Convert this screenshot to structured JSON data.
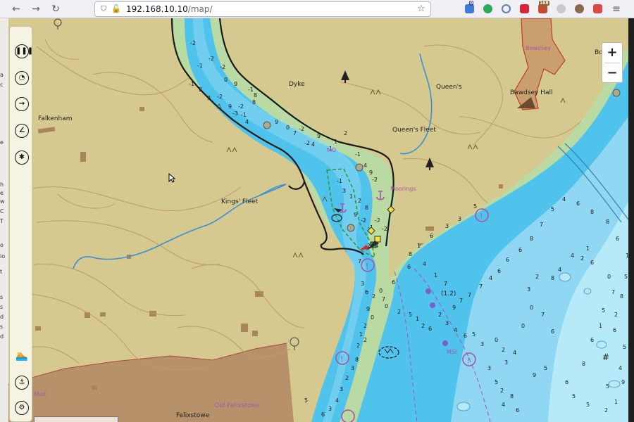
{
  "browser": {
    "address": "192.168.10.10/map/",
    "address_host": "192.168.10.10",
    "address_path": "/map/",
    "extension_badges": {
      "ext1": "0",
      "ext6": "168"
    }
  },
  "map": {
    "places": [
      {
        "id": "falkenham",
        "text": "Falkenham"
      },
      {
        "id": "kings-fleet",
        "text": "Kings' Fleet"
      },
      {
        "id": "dyke",
        "text": "Dyke"
      },
      {
        "id": "queens",
        "text": "Queen's"
      },
      {
        "id": "queens-fleet",
        "text": "Queen's Fleet"
      },
      {
        "id": "bawdsey-hall",
        "text": "Bawdsey Hall"
      },
      {
        "id": "bawdsey",
        "text": "Bawdsey"
      },
      {
        "id": "boathouse",
        "text": "Boathse"
      },
      {
        "id": "moorings",
        "text": "Moorings"
      },
      {
        "id": "felixstowe",
        "text": "Felixstowe"
      },
      {
        "id": "old-felixstowe",
        "text": "Old Felixstowe"
      },
      {
        "id": "mud-label",
        "text": "Mud"
      },
      {
        "id": "mo-label",
        "text": "MO"
      },
      {
        "id": "msi-label",
        "text": "MSt"
      },
      {
        "id": "height-label",
        "text": "(1.2)"
      }
    ],
    "colors": {
      "land": "#d5c98f",
      "urban": "#b7916a",
      "intertidal": "#b9dba3",
      "shallow": "#4fc3ec",
      "mid": "#8fd7f2",
      "deep": "#b6eaf8",
      "contour": "#c09a62",
      "coast": "#1a1a1a"
    },
    "soundings": [
      "-2",
      "-1",
      "-2",
      "-2",
      "-1",
      "2",
      "3",
      "-2",
      "0",
      "9",
      "-1",
      "8",
      "9",
      "-3",
      "-2",
      "-1",
      "4",
      "8",
      "9",
      "0",
      "7",
      "-2",
      "-2",
      "4",
      "9",
      "-1",
      "1",
      "2",
      "-1",
      "4",
      "9",
      "-2",
      "-1",
      "3",
      "1",
      "2",
      "8",
      "9",
      "-2",
      "-1",
      "-2",
      "-2",
      "-2",
      "4",
      "7",
      "3",
      "6",
      "2",
      "0",
      "7",
      "0",
      "9",
      "0",
      "2",
      "1",
      "2",
      "2",
      "8",
      "3",
      "2",
      "3",
      "4",
      "3",
      "6",
      "5",
      "6",
      "6",
      "2",
      "5",
      "1",
      "2",
      "6",
      "2",
      "3",
      "4",
      "6",
      "5",
      "3",
      "0",
      "2",
      "3",
      "3",
      "4",
      "5",
      "2",
      "8",
      "4",
      "6",
      "9",
      "5",
      "6",
      "7",
      "0",
      "0",
      "3",
      "2",
      "8",
      "4",
      "4",
      "2",
      "1",
      "6",
      "0",
      "7",
      "5",
      "1",
      "6",
      "8",
      "6",
      "5",
      "5",
      "2",
      "1",
      "9",
      "5",
      "4",
      "5",
      "6",
      "2",
      "8",
      "5",
      "1",
      "6",
      "8",
      "8",
      "6",
      "4",
      "5",
      "7",
      "8",
      "6",
      "6",
      "6",
      "4",
      "7",
      "7",
      "7",
      "9",
      "7",
      "1",
      "4",
      "8",
      "1",
      "6",
      "3",
      "3",
      "5"
    ]
  },
  "tools": {
    "panel_buttons": [
      {
        "id": "layers",
        "icon": "layers-icon",
        "glyph": "❚❚❚"
      },
      {
        "id": "timer",
        "icon": "timer-icon",
        "glyph": "◔"
      },
      {
        "id": "route",
        "icon": "route-icon",
        "glyph": "→"
      },
      {
        "id": "measure",
        "icon": "measure-icon",
        "glyph": "∠"
      },
      {
        "id": "sun",
        "icon": "sun-icon",
        "glyph": "✱"
      }
    ],
    "bottom_buttons": [
      {
        "id": "swim",
        "icon": "swimmer-icon",
        "glyph": "🏊"
      },
      {
        "id": "anchor",
        "icon": "anchor-icon",
        "glyph": "⚓"
      },
      {
        "id": "settings",
        "icon": "settings-icon",
        "glyph": "⚙"
      }
    ],
    "zoom_in": "+",
    "zoom_out": "−"
  }
}
